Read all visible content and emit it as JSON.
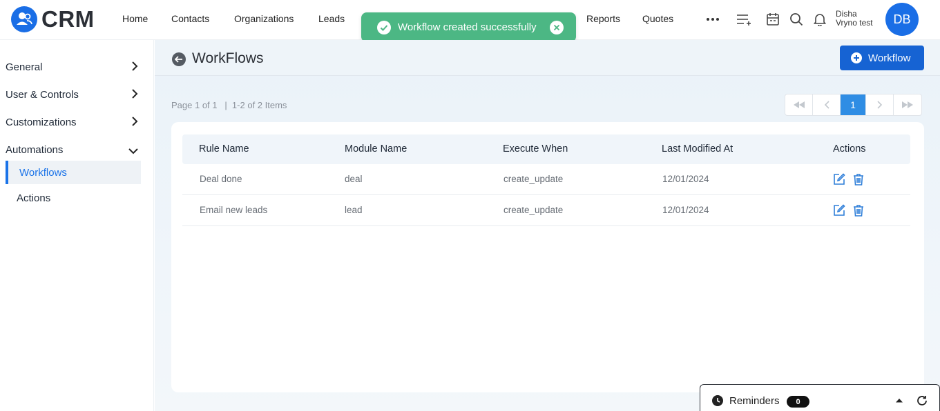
{
  "app": {
    "logo_text": "CRM"
  },
  "nav": {
    "items": [
      "Home",
      "Contacts",
      "Organizations",
      "Leads",
      "Reports",
      "Quotes"
    ]
  },
  "user": {
    "name_line1": "Disha",
    "name_line2": "Vryno test",
    "initials": "DB"
  },
  "toast": {
    "message": "Workflow created successfully"
  },
  "sidebar": {
    "sections": [
      {
        "label": "General",
        "expanded": false
      },
      {
        "label": "User & Controls",
        "expanded": false
      },
      {
        "label": "Customizations",
        "expanded": false
      },
      {
        "label": "Automations",
        "expanded": true
      }
    ],
    "sub_items": [
      {
        "label": "Workflows",
        "active": true
      },
      {
        "label": "Actions",
        "active": false
      }
    ]
  },
  "page": {
    "title": "WorkFlows",
    "new_button_label": "Workflow",
    "pager_info": "Page 1 of 1   |  1-2 of 2 Items",
    "current_page": "1"
  },
  "table": {
    "columns": [
      "Rule Name",
      "Module Name",
      "Execute When",
      "Last Modified At",
      "Actions"
    ],
    "rows": [
      {
        "rule": "Deal done",
        "module": "deal",
        "execute": "create_update",
        "modified": "12/01/2024"
      },
      {
        "rule": "Email new leads",
        "module": "lead",
        "execute": "create_update",
        "modified": "12/01/2024"
      }
    ]
  },
  "reminders": {
    "label": "Reminders",
    "count": "0"
  },
  "colors": {
    "primary": "#1663d3",
    "toast": "#4cb784",
    "active_text": "#1a73e8"
  },
  "icons": [
    "menu-plus-icon",
    "calendar-icon",
    "search-icon",
    "bell-icon",
    "more-icon",
    "back-arrow-icon",
    "plus-circle-icon",
    "edit-icon",
    "trash-icon",
    "clock-icon",
    "caret-up-icon",
    "refresh-icon",
    "chevron-right-icon",
    "chevron-down-icon",
    "check-circle-icon",
    "close-circle-icon"
  ]
}
